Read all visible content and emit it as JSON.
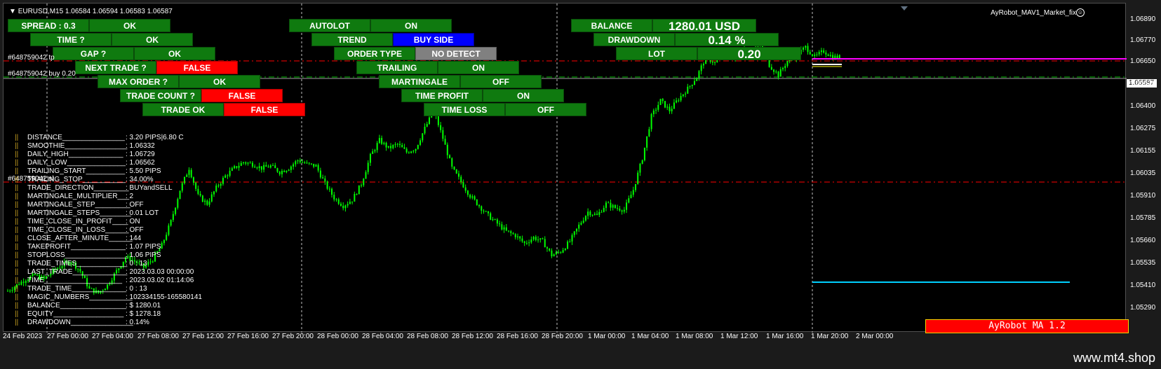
{
  "header": {
    "symbol_line": "EURUSD,M15  1.06584 1.06594 1.06583 1.06587",
    "ea_name": "AyRobot_MAV1_Market_fix",
    "smile": "☺"
  },
  "panel_left": {
    "spread_label": "SPREAD : 0.3",
    "spread_value": "OK",
    "time_label": "TIME ?",
    "time_value": "OK",
    "gap_label": "GAP ?",
    "gap_value": "OK",
    "next_trade_label": "NEXT TRADE ?",
    "next_trade_value": "FALSE",
    "max_order_label": "MAX ORDER ?",
    "max_order_value": "OK",
    "trade_count_label": "TRADE COUNT ?",
    "trade_count_value": "FALSE",
    "trade_ok_label": "TRADE OK",
    "trade_ok_value": "FALSE"
  },
  "panel_mid": {
    "autolot_label": "AUTOLOT",
    "autolot_value": "ON",
    "trend_label": "TREND",
    "trend_value": "BUY SIDE",
    "order_type_label": "ORDER TYPE",
    "order_type_value": "NO DETECT",
    "trailing_label": "TRAILING",
    "trailing_value": "ON",
    "martingale_label": "MARTINGALE",
    "martingale_value": "OFF",
    "time_profit_label": "TIME PROFIT",
    "time_profit_value": "ON",
    "time_loss_label": "TIME LOSS",
    "time_loss_value": "OFF"
  },
  "panel_right": {
    "balance_label": "BALANCE",
    "balance_value": "1280.01 USD",
    "drawdown_label": "DRAWDOWN",
    "drawdown_value": "0.14 %",
    "lot_label": "LOT",
    "lot_value": "0.20"
  },
  "orders": {
    "tp_line": "#648759042 tp",
    "buy_line": "#648759042 buy 0.20",
    "sl_line": "#648759042 sl"
  },
  "info_rows": [
    {
      "label": "DISTANCE________________",
      "value": ": 3.20 PIPS|6.80 C"
    },
    {
      "label": "SMOOTHIE________________",
      "value": ": 1.06332"
    },
    {
      "label": "DAILY_HIGH______________",
      "value": ": 1.06729"
    },
    {
      "label": "DAILY_LOW_______________",
      "value": ": 1.06562"
    },
    {
      "label": "TRAILING_START__________",
      "value": ": 5.50 PIPS"
    },
    {
      "label": "TRAILING_STOP___________",
      "value": ": 34.00%"
    },
    {
      "label": "TRADE_DIRECTION_________",
      "value": ": BUYandSELL"
    },
    {
      "label": "MARTINGALE_MULTIPLIER___",
      "value": ": 2"
    },
    {
      "label": "MARTINGALE_STEP_________",
      "value": ": OFF"
    },
    {
      "label": "MARTINGALE_STEPS________",
      "value": ": 0.01 LOT"
    },
    {
      "label": "TIME_CLOSE_IN_PROFIT____",
      "value": ": ON"
    },
    {
      "label": "TIME_CLOSE_IN_LOSS______",
      "value": ": OFF"
    },
    {
      "label": "CLOSE_AFTER_MINUTE______",
      "value": ": 144"
    },
    {
      "label": "TAKEPROFIT______________",
      "value": ": 1.07 PIPS"
    },
    {
      "label": "STOPLOSS________________",
      "value": ": 1.06 PIPS"
    },
    {
      "label": "TRADE_TIMES_____________",
      "value": ": 0 : 13"
    },
    {
      "label": "LAST_TRADE______________",
      "value": ": 2023.03.03 00:00:00"
    },
    {
      "label": "TIME____________________",
      "value": ": 2023.03.02 01:14:06"
    },
    {
      "label": "TRADE_TIME______________",
      "value": ": 0 : 13"
    },
    {
      "label": "MAGIC_NUMBERS___________",
      "value": ": 102334155-165580141"
    },
    {
      "label": "BALANCE_________________",
      "value": ": $ 1280.01"
    },
    {
      "label": "EQUITY__________________",
      "value": ": $ 1278.18"
    },
    {
      "label": "DRAWDOWN________________",
      "value": ": 0.14%"
    }
  ],
  "price_axis": [
    "1.06890",
    "1.06770",
    "1.06650",
    "1.06525",
    "1.06400",
    "1.06275",
    "1.06155",
    "1.06035",
    "1.05910",
    "1.05785",
    "1.05660",
    "1.05535",
    "1.05410",
    "1.05290"
  ],
  "current_price": "1.06587",
  "time_axis": [
    "24 Feb 2023",
    "27 Feb 00:00",
    "27 Feb 04:00",
    "27 Feb 08:00",
    "27 Feb 12:00",
    "27 Feb 16:00",
    "27 Feb 20:00",
    "28 Feb 00:00",
    "28 Feb 04:00",
    "28 Feb 08:00",
    "28 Feb 12:00",
    "28 Feb 16:00",
    "28 Feb 20:00",
    "1 Mar 00:00",
    "1 Mar 04:00",
    "1 Mar 08:00",
    "1 Mar 12:00",
    "1 Mar 16:00",
    "1 Mar 20:00",
    "2 Mar 00:00"
  ],
  "robot_label": "AyRobot MA 1.2",
  "site": "www.mt4.shop",
  "colors": {
    "candle": "#00ff00",
    "grid": "#c0c0c0",
    "tp_line": "#ff0000",
    "buy_line": "#00c000",
    "magenta": "#ff00ff",
    "cyan": "#00d0ff"
  },
  "chart_data": {
    "type": "candlestick",
    "ylim": [
      1.0529,
      1.0695
    ],
    "closes": [
      1.055,
      1.0553,
      1.0556,
      1.0558,
      1.0556,
      1.056,
      1.0563,
      1.0565,
      1.056,
      1.0551,
      1.0549,
      1.0553,
      1.056,
      1.0567,
      1.0565,
      1.0562,
      1.0566,
      1.0573,
      1.0585,
      1.0601,
      1.0612,
      1.0598,
      1.0594,
      1.0602,
      1.0608,
      1.0612,
      1.0615,
      1.0614,
      1.0612,
      1.0613,
      1.061,
      1.0612,
      1.0616,
      1.0614,
      1.0613,
      1.0604,
      1.0597,
      1.0593,
      1.0596,
      1.0604,
      1.0618,
      1.0626,
      1.0622,
      1.0624,
      1.062,
      1.0622,
      1.0632,
      1.0641,
      1.0627,
      1.0612,
      1.0605,
      1.0598,
      1.0593,
      1.0588,
      1.0584,
      1.058,
      1.0578,
      1.0574,
      1.0577,
      1.0575,
      1.0568,
      1.057,
      1.0575,
      1.0583,
      1.059,
      1.0588,
      1.0594,
      1.0592,
      1.0591,
      1.0601,
      1.0617,
      1.0638,
      1.0646,
      1.0641,
      1.0647,
      1.0652,
      1.0658,
      1.0668,
      1.0665,
      1.067,
      1.0667,
      1.0672,
      1.0671,
      1.0675,
      1.0664,
      1.0659,
      1.0666,
      1.0669,
      1.0673,
      1.0668,
      1.0671,
      1.0668
    ]
  }
}
